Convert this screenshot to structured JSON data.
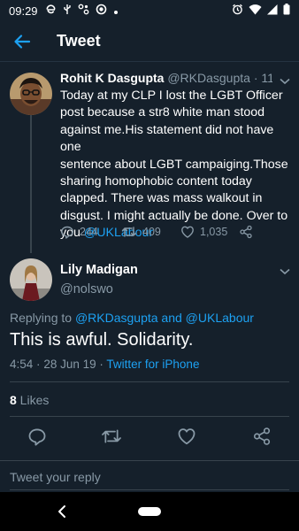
{
  "status_bar": {
    "time": "09:29",
    "icons": [
      "browser-e-icon",
      "usb-icon",
      "connection-icon",
      "vpn-icon",
      "dot-icon",
      "alarm-icon",
      "wifi-icon",
      "signal-icon",
      "battery-icon"
    ]
  },
  "header": {
    "title": "Tweet",
    "back_icon": "arrow-left-icon"
  },
  "tweet1": {
    "name": "Rohit K Dasgupta",
    "handle": "@RKDasgupta",
    "separator": "·",
    "time": "11h",
    "text_lines": [
      "Today at my CLP I lost the LGBT Officer",
      "post because a str8 white man stood",
      "against me.His statement did not have one",
      "sentence about LGBT campaiging.Those",
      "sharing homophobic content today",
      "clapped. There was mass walkout in",
      "disgust. I might actually be done. Over to"
    ],
    "text_last_prefix": "you ",
    "mention": "@UKLabour",
    "replies": "244",
    "retweets": "409",
    "likes": "1,035"
  },
  "tweet2": {
    "name": "Lily Madigan",
    "handle": "@nolswo",
    "replying_prefix": "Replying to ",
    "replying_to_1": "@RKDasgupta",
    "replying_and": " and ",
    "replying_to_2": "@UKLabour",
    "text": "This is awful. Solidarity.",
    "time": "4:54",
    "separator": "·",
    "date": "28 Jun 19",
    "source_separator": "·",
    "source": "Twitter for iPhone",
    "likes_count": "8",
    "likes_label": " Likes"
  },
  "reply_bar": {
    "placeholder": "Tweet your reply"
  },
  "nav_bar": {
    "back_icon": "nav-back-icon",
    "home_icon": "home-pill-icon"
  },
  "colors": {
    "background": "#15202b",
    "accent": "#1da1f2",
    "secondary_text": "#8899a6",
    "divider": "#38444d"
  }
}
